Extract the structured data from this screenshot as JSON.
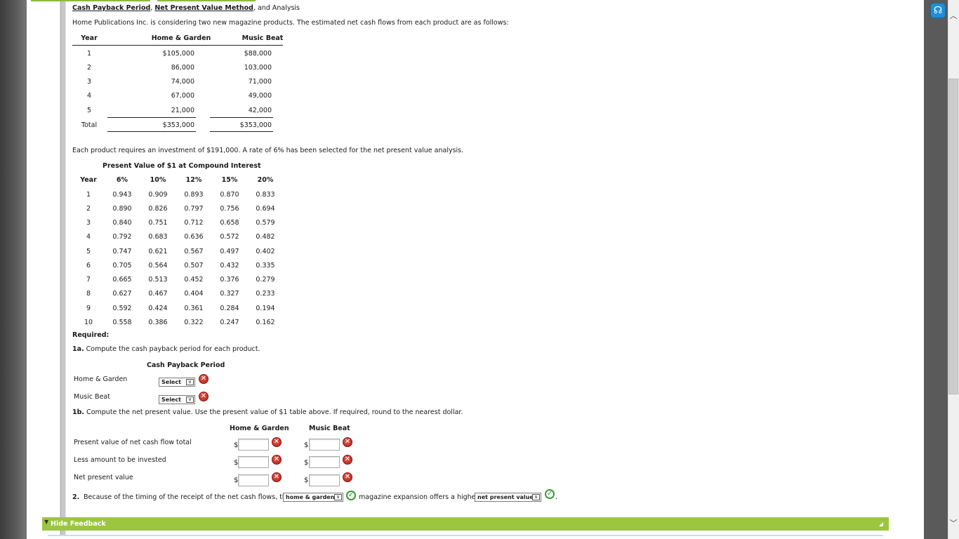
{
  "title": {
    "link1": "Cash Payback Period",
    "sep1": ",",
    "link2": "Net Present Value Method",
    "rest": ", and Analysis"
  },
  "intro": "Home Publications Inc. is considering two new magazine products. The estimated net cash flows from each product are as follows:",
  "cashflow_table": {
    "headers": [
      "Year",
      "Home & Garden",
      "Music Beat"
    ],
    "rows": [
      [
        "1",
        "$105,000",
        "$88,000"
      ],
      [
        "2",
        "86,000",
        "103,000"
      ],
      [
        "3",
        "74,000",
        "71,000"
      ],
      [
        "4",
        "67,000",
        "49,000"
      ],
      [
        "5",
        "21,000",
        "42,000"
      ]
    ],
    "total": [
      "Total",
      "$353,000",
      "$353,000"
    ]
  },
  "investment_text": "Each product requires an investment of $191,000. A rate of 6% has been selected for the net present value analysis.",
  "pv_table": {
    "caption": "Present Value of $1 at Compound Interest",
    "headers": [
      "Year",
      "6%",
      "10%",
      "12%",
      "15%",
      "20%"
    ],
    "rows": [
      [
        "1",
        "0.943",
        "0.909",
        "0.893",
        "0.870",
        "0.833"
      ],
      [
        "2",
        "0.890",
        "0.826",
        "0.797",
        "0.756",
        "0.694"
      ],
      [
        "3",
        "0.840",
        "0.751",
        "0.712",
        "0.658",
        "0.579"
      ],
      [
        "4",
        "0.792",
        "0.683",
        "0.636",
        "0.572",
        "0.482"
      ],
      [
        "5",
        "0.747",
        "0.621",
        "0.567",
        "0.497",
        "0.402"
      ],
      [
        "6",
        "0.705",
        "0.564",
        "0.507",
        "0.432",
        "0.335"
      ],
      [
        "7",
        "0.665",
        "0.513",
        "0.452",
        "0.376",
        "0.279"
      ],
      [
        "8",
        "0.627",
        "0.467",
        "0.404",
        "0.327",
        "0.233"
      ],
      [
        "9",
        "0.592",
        "0.424",
        "0.361",
        "0.284",
        "0.194"
      ],
      [
        "10",
        "0.558",
        "0.386",
        "0.322",
        "0.247",
        "0.162"
      ]
    ]
  },
  "required_label": "Required:",
  "q1a": {
    "num": "1a.",
    "text": "Compute the cash payback period for each product."
  },
  "payback": {
    "heading": "Cash Payback Period",
    "home_label": "Home & Garden",
    "music_label": "Music Beat",
    "home_select": "Select",
    "music_select": "Select"
  },
  "q1b": {
    "num": "1b.",
    "text": "Compute the net present value. Use the present value of $1 table above. If required, round to the nearest dollar."
  },
  "npv": {
    "col_home": "Home & Garden",
    "col_music": "Music Beat",
    "rows": [
      "Present value of net cash flow total",
      "Less amount to be invested",
      "Net present value"
    ],
    "currency": "$",
    "values": [
      "",
      "",
      "",
      "",
      "",
      ""
    ]
  },
  "q2": {
    "num": "2.",
    "text_before": "Because of the timing of the receipt of the net cash flows, the",
    "select1": "home & garden",
    "text_mid": "magazine expansion offers a higher",
    "select2": "net present value",
    "text_end": "."
  },
  "feedback_label": "Hide Feedback",
  "icons": {
    "incorrect": "x-circle-icon",
    "correct": "check-circle-icon",
    "help": "headset-icon",
    "dropdown": "chevron-down-icon"
  },
  "colors": {
    "feedback_bar": "#9cc63f",
    "incorrect": "#c0281e",
    "correct": "#3a9a3a",
    "help": "#1e8fd6"
  }
}
